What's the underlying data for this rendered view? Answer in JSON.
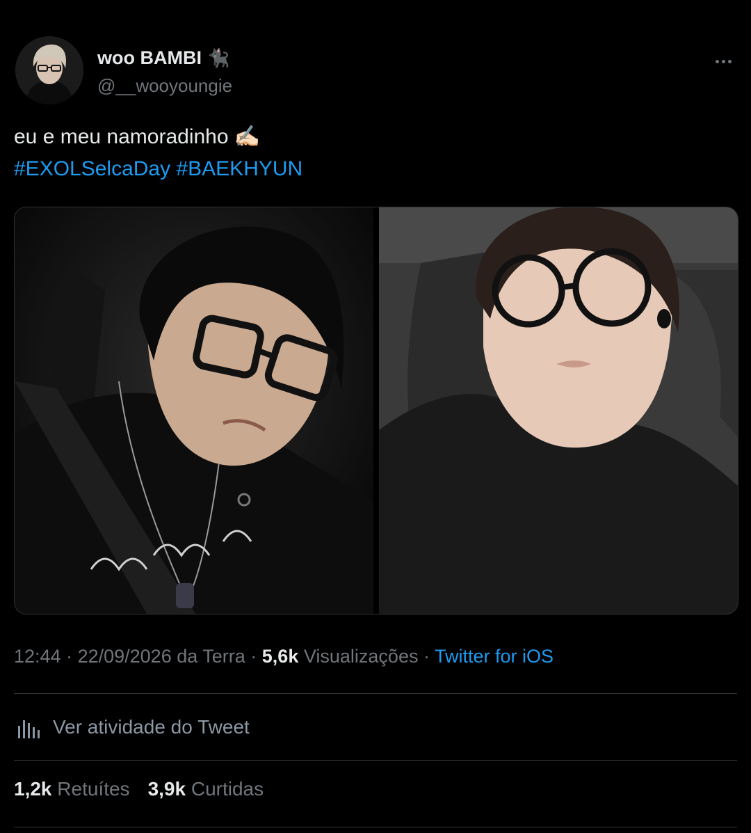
{
  "author": {
    "display_name": "woo BAMBI",
    "name_emoji": "🐈‍⬛",
    "handle": "@__wooyoungie"
  },
  "tweet": {
    "text": "eu e meu namoradinho",
    "text_emoji": "✍🏻",
    "hashtags": [
      "#EXOLSelcaDay",
      "#BAEKHYUN"
    ]
  },
  "meta": {
    "time": "12:44",
    "separator": " · ",
    "date": "22/09/2026 da Terra",
    "views_count": "5,6k",
    "views_label": "Visualizações",
    "source": "Twitter for iOS"
  },
  "activity": {
    "label": "Ver atividade do Tweet",
    "icon": "analytics-icon"
  },
  "stats": {
    "retweets_count": "1,2k",
    "retweets_label": "Retuítes",
    "likes_count": "3,9k",
    "likes_label": "Curtidas"
  },
  "colors": {
    "background": "#000000",
    "link": "#1d9bf0",
    "secondary_text": "#71767b",
    "divider": "#2f3336"
  }
}
